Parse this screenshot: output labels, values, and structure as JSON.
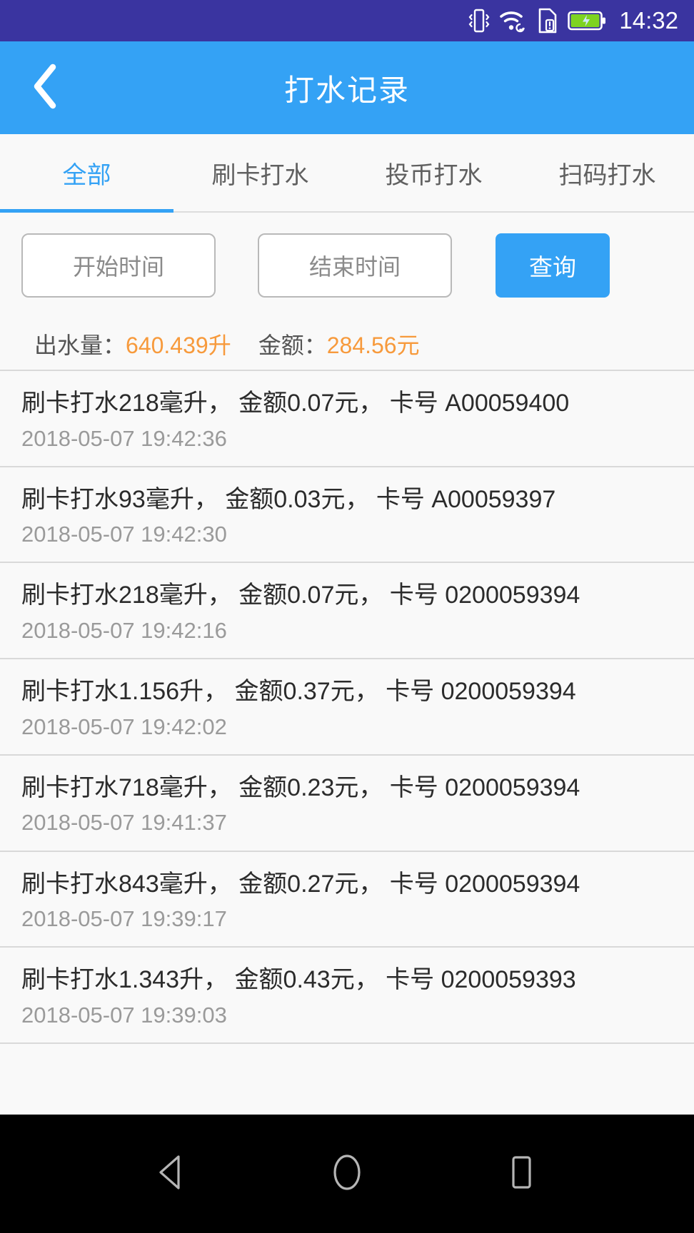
{
  "statusbar": {
    "time": "14:32",
    "icons": [
      "vibrate-icon",
      "wifi-icon",
      "sim-card-alert-icon",
      "battery-charging-icon"
    ]
  },
  "header": {
    "title": "打水记录",
    "back_icon": "chevron-left-icon",
    "background_color": "#34a2f5"
  },
  "tabs": [
    {
      "label": "全部",
      "active": true
    },
    {
      "label": "刷卡打水",
      "active": false
    },
    {
      "label": "投币打水",
      "active": false
    },
    {
      "label": "扫码打水",
      "active": false
    }
  ],
  "filter": {
    "start_time_label": "开始时间",
    "end_time_label": "结束时间",
    "query_label": "查询"
  },
  "summary": {
    "volume_label": "出水量：",
    "volume_value": "640.439升",
    "amount_label": "金额：",
    "amount_value": "284.56元",
    "accent_color": "#f79a3c"
  },
  "records": [
    {
      "main": "刷卡打水218毫升，  金额0.07元，  卡号 A00059400",
      "time": "2018-05-07 19:42:36"
    },
    {
      "main": "刷卡打水93毫升，  金额0.03元，  卡号 A00059397",
      "time": "2018-05-07 19:42:30"
    },
    {
      "main": "刷卡打水218毫升，  金额0.07元，  卡号 0200059394",
      "time": "2018-05-07 19:42:16"
    },
    {
      "main": "刷卡打水1.156升，  金额0.37元，  卡号 0200059394",
      "time": "2018-05-07 19:42:02"
    },
    {
      "main": "刷卡打水718毫升，  金额0.23元，  卡号 0200059394",
      "time": "2018-05-07 19:41:37"
    },
    {
      "main": "刷卡打水843毫升，  金额0.27元，  卡号 0200059394",
      "time": "2018-05-07 19:39:17"
    },
    {
      "main": "刷卡打水1.343升，  金额0.43元，  卡号 0200059393",
      "time": "2018-05-07 19:39:03"
    }
  ],
  "navbar": {
    "back_icon": "triangle-back-icon",
    "home_icon": "circle-home-icon",
    "recents_icon": "square-recents-icon"
  }
}
